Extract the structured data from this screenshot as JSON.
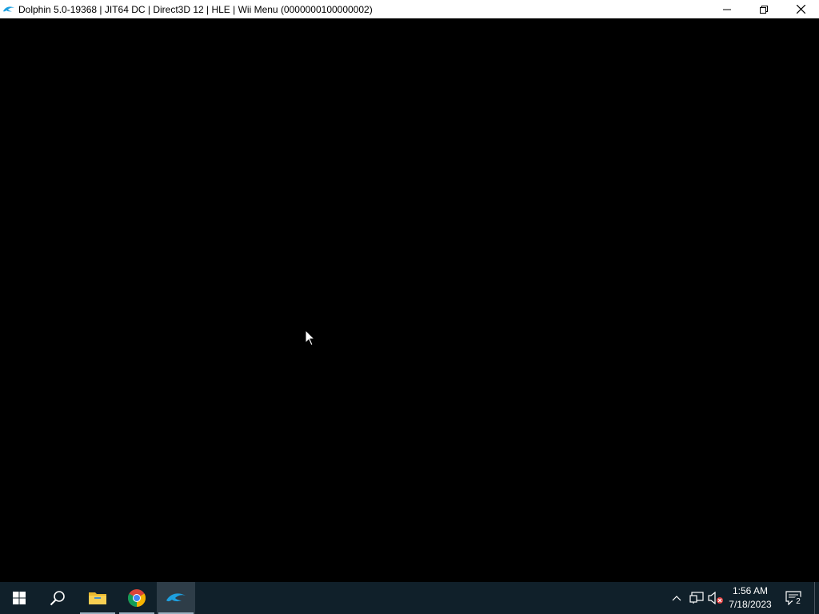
{
  "window": {
    "title": "Dolphin 5.0-19368 | JIT64 DC | Direct3D 12 | HLE | Wii Menu (0000000100000002)",
    "icon": "dolphin-icon",
    "controls": [
      "minimize-icon",
      "restore-icon",
      "close-icon"
    ]
  },
  "taskbar": {
    "pinned": [
      {
        "name": "start",
        "icon": "windows-logo-icon"
      },
      {
        "name": "search",
        "icon": "search-icon"
      },
      {
        "name": "file-explorer",
        "icon": "folder-icon"
      },
      {
        "name": "chrome",
        "icon": "chrome-icon"
      },
      {
        "name": "dolphin",
        "icon": "dolphin-icon",
        "active": true
      }
    ],
    "tray": {
      "icons": [
        "chevron-up-icon",
        "network-icon",
        "volume-muted-icon"
      ],
      "time": "1:56 AM",
      "date": "7/18/2023",
      "notification_count": "2"
    }
  },
  "colors": {
    "taskbar_bg": "#10202a",
    "accent_blue": "#1ea0e0",
    "chrome_red": "#db4437",
    "chrome_green": "#0f9d58",
    "chrome_yellow": "#f4b400"
  }
}
